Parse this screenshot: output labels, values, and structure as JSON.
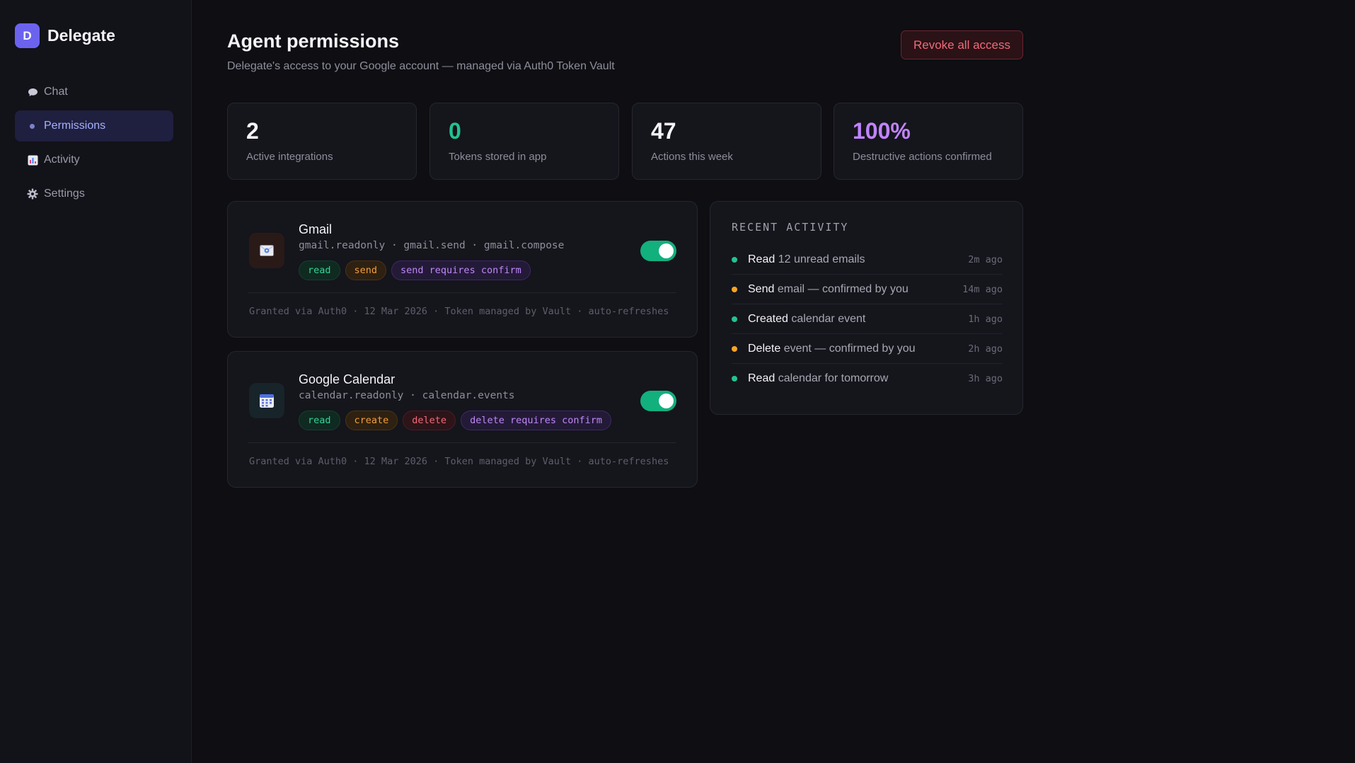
{
  "app": {
    "logo_letter": "D",
    "name": "Delegate"
  },
  "nav": {
    "items": [
      {
        "label": "Chat",
        "icon": "chat-bubble-icon"
      },
      {
        "label": "Permissions",
        "icon": "dot-icon"
      },
      {
        "label": "Activity",
        "icon": "bar-chart-icon"
      },
      {
        "label": "Settings",
        "icon": "gear-icon"
      }
    ],
    "active": "Permissions"
  },
  "header": {
    "title": "Agent permissions",
    "subtitle": "Delegate's access to your Google account — managed via Auth0 Token Vault",
    "revoke_label": "Revoke all access"
  },
  "stats": [
    {
      "value": "2",
      "label": "Active integrations",
      "color": "#f4f4f8"
    },
    {
      "value": "0",
      "label": "Tokens stored in app",
      "color": "#22c38e"
    },
    {
      "value": "47",
      "label": "Actions this week",
      "color": "#f4f4f8"
    },
    {
      "value": "100%",
      "label": "Destructive actions confirmed",
      "color": "#c084fc"
    }
  ],
  "integrations": [
    {
      "name": "Gmail",
      "icon": "mail-icon",
      "scopes": "gmail.readonly · gmail.send · gmail.compose",
      "tags": [
        "read",
        "send",
        "send requires confirm"
      ],
      "enabled": true,
      "footer": "Granted via Auth0 · 12 Mar 2026 · Token managed by Vault · auto-refreshes"
    },
    {
      "name": "Google Calendar",
      "icon": "calendar-icon",
      "scopes": "calendar.readonly · calendar.events",
      "tags": [
        "read",
        "create",
        "delete",
        "delete requires confirm"
      ],
      "enabled": true,
      "footer": "Granted via Auth0 · 12 Mar 2026 · Token managed by Vault · auto-refreshes"
    }
  ],
  "activity": {
    "title": "RECENT ACTIVITY",
    "items": [
      {
        "verb": "Read",
        "text": "12 unread emails",
        "time": "2m ago",
        "color": "#22c38e"
      },
      {
        "verb": "Send",
        "text": "email — confirmed by you",
        "time": "14m ago",
        "color": "#f5a524"
      },
      {
        "verb": "Created",
        "text": "calendar event",
        "time": "1h ago",
        "color": "#22c38e"
      },
      {
        "verb": "Delete",
        "text": "event — confirmed by you",
        "time": "2h ago",
        "color": "#f5a524"
      },
      {
        "verb": "Read",
        "text": "calendar for tomorrow",
        "time": "3h ago",
        "color": "#22c38e"
      }
    ]
  }
}
